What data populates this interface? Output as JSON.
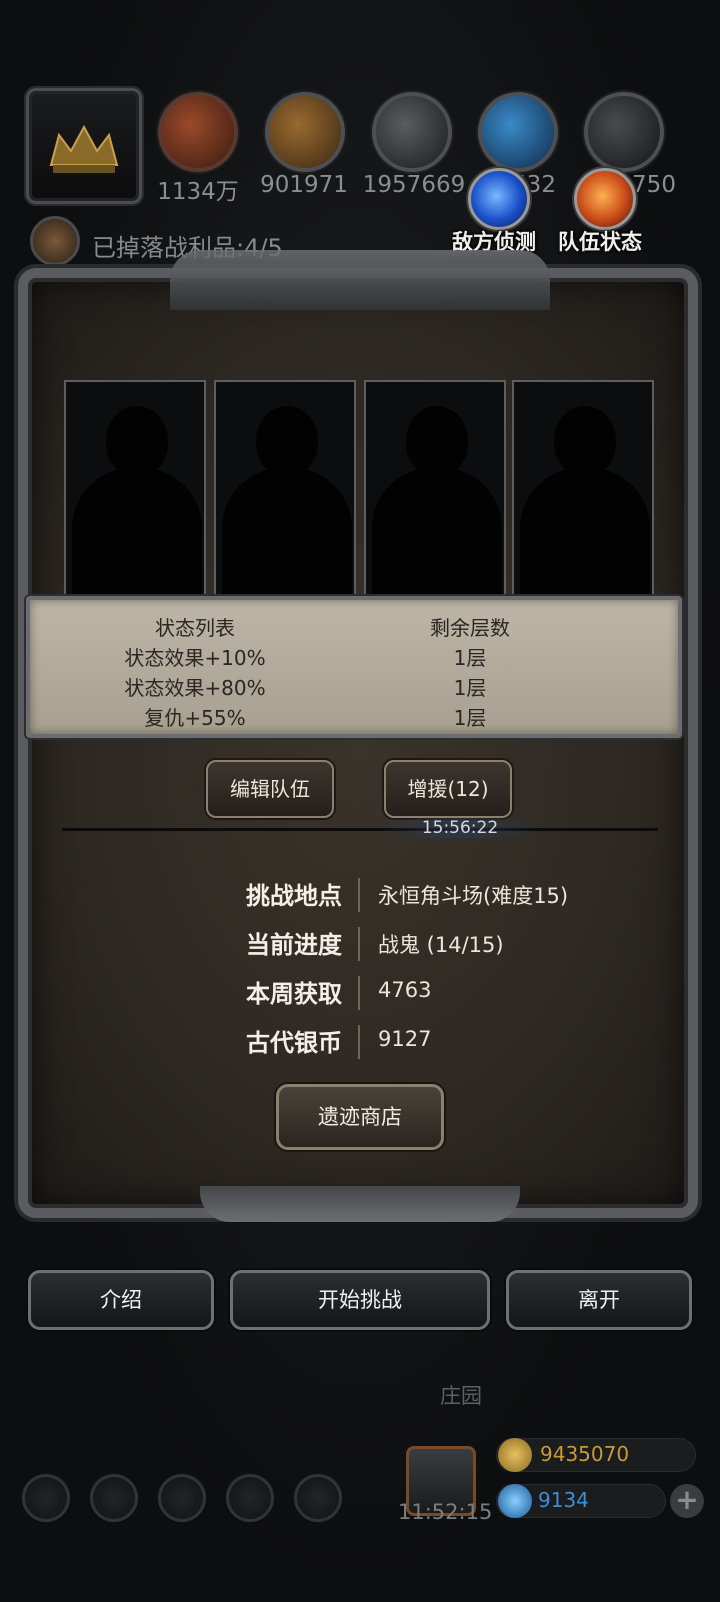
{
  "resources": [
    {
      "name": "food",
      "value": "1134万"
    },
    {
      "name": "wood",
      "value": "901971"
    },
    {
      "name": "iron",
      "value": "1957669"
    },
    {
      "name": "crystal",
      "value": "532"
    },
    {
      "name": "stone",
      "value": "750"
    }
  ],
  "loot_status": "已掉落战利品:4/5",
  "top_buttons": {
    "enemy_scout": "敌方侦测",
    "team_status": "队伍状态"
  },
  "status_table": {
    "headers": [
      "状态列表",
      "剩余层数"
    ],
    "rows": [
      [
        "状态效果+10%",
        "1层"
      ],
      [
        "状态效果+80%",
        "1层"
      ],
      [
        "复仇+55%",
        "1层"
      ]
    ]
  },
  "team_buttons": {
    "edit_team": "编辑队伍",
    "reinforce": "增援(12)",
    "timer": "15:56:22"
  },
  "info": [
    {
      "key": "挑战地点",
      "value": "永恒角斗场(难度15)"
    },
    {
      "key": "当前进度",
      "value": "战鬼 (14/15)"
    },
    {
      "key": "本周获取",
      "value": "4763"
    },
    {
      "key": "古代银币",
      "value": "9127"
    }
  ],
  "shop_button": "遗迹商店",
  "actions": {
    "intro": "介绍",
    "start": "开始挑战",
    "leave": "离开"
  },
  "background": {
    "location": "庄园",
    "gift_timer": "11:52:15",
    "gold": "9435070",
    "gems": "9134"
  },
  "colors": {
    "gold": "#c89a3a",
    "gem": "#3a8fd8",
    "orb_blue": "#2a6fe0",
    "orb_fire": "#d86a20"
  }
}
